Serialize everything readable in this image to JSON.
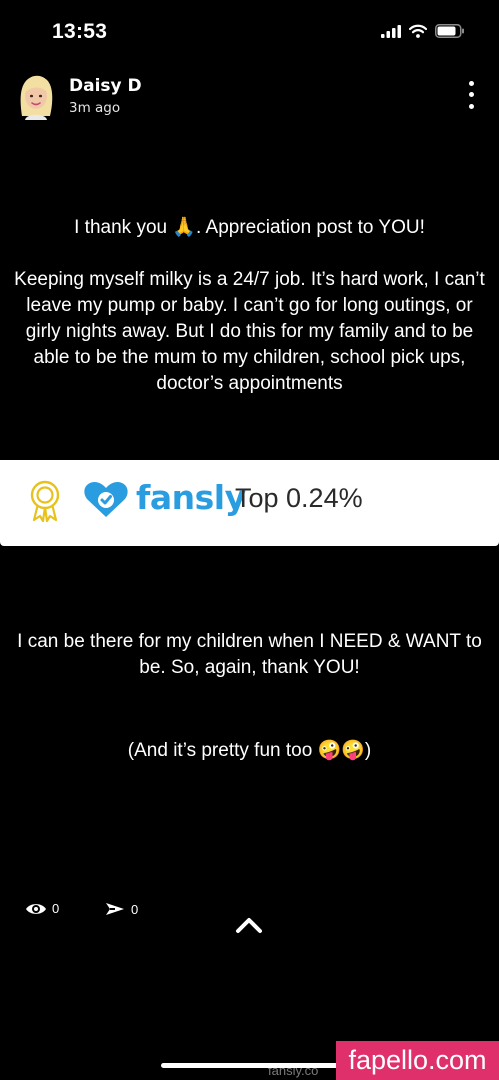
{
  "status_bar": {
    "time": "13:53",
    "icons": [
      "cellular-signal-icon",
      "wifi-icon",
      "battery-icon"
    ]
  },
  "story": {
    "author": "Daisy D",
    "posted": "3m ago"
  },
  "post": {
    "paragraph1": "I thank you 🙏. Appreciation post to YOU!",
    "paragraph2": "Keeping myself milky is a 24/7 job. It’s hard work, I can’t leave my pump or baby. I can’t go for long outings, or girly nights away. But I do this for my family and to be able to be the mum to my children, school pick ups, doctor’s appointments",
    "paragraph3": "I can be there for my children when I NEED & WANT to be. So, again, thank YOU!",
    "paragraph4": "(And it’s pretty fun too 🤪🤪)"
  },
  "banner": {
    "brand": "fansly",
    "rank": "Top 0.24%",
    "brand_color": "#2a9ce0",
    "badge_color": "#e8c21c"
  },
  "stats": {
    "views": "0",
    "shares": "0"
  },
  "footer": {
    "url_fragment": "fansly.co",
    "watermark": "fapello.com",
    "watermark_color": "#e0306c"
  }
}
